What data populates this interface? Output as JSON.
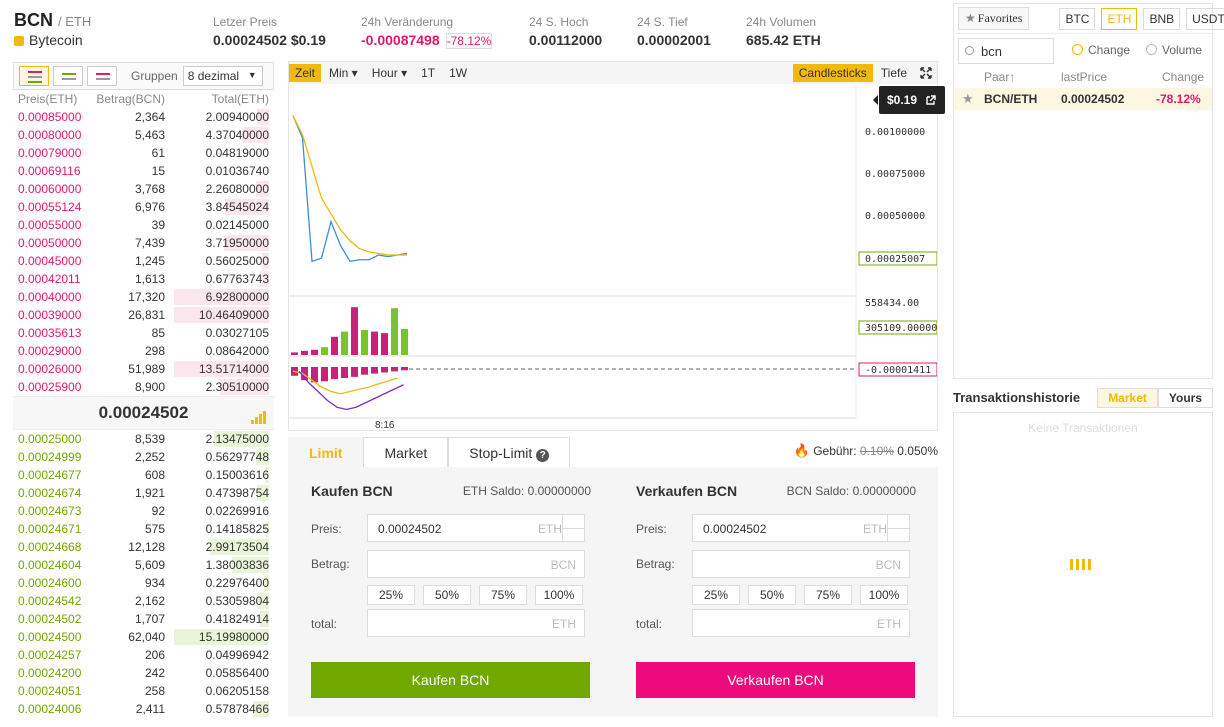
{
  "header": {
    "base": "BCN",
    "quote": "/ ETH",
    "coin_name": "Bytecoin",
    "stats": [
      {
        "label": "Letzer Preis",
        "value": "0.00024502 $0.19"
      },
      {
        "label": "24h Veränderung",
        "value": "-0.00087498",
        "pct": "-78.12%"
      },
      {
        "label": "24 S. Hoch",
        "value": "0.00112000"
      },
      {
        "label": "24 S. Tief",
        "value": "0.00002001"
      },
      {
        "label": "24h Volumen",
        "value": "685.42 ETH"
      }
    ]
  },
  "orderbook": {
    "group_label": "Gruppen",
    "group_value": "8 dezimal",
    "headers": [
      "Preis(ETH)",
      "Betrag(BCN)",
      "Total(ETH)"
    ],
    "asks": [
      {
        "price": "0.00085000",
        "amount": "2,364",
        "total": "2.00940000",
        "depth": 0.13
      },
      {
        "price": "0.00080000",
        "amount": "5,463",
        "total": "4.37040000",
        "depth": 0.28
      },
      {
        "price": "0.00079000",
        "amount": "61",
        "total": "0.04819000",
        "depth": 0.0
      },
      {
        "price": "0.00069116",
        "amount": "15",
        "total": "0.01036740",
        "depth": 0.0
      },
      {
        "price": "0.00060000",
        "amount": "3,768",
        "total": "2.26080000",
        "depth": 0.14
      },
      {
        "price": "0.00055124",
        "amount": "6,976",
        "total": "3.84545024",
        "depth": 0.46
      },
      {
        "price": "0.00055000",
        "amount": "39",
        "total": "0.02145000",
        "depth": 0.0
      },
      {
        "price": "0.00050000",
        "amount": "7,439",
        "total": "3.71950000",
        "depth": 0.47
      },
      {
        "price": "0.00045000",
        "amount": "1,245",
        "total": "0.56025000",
        "depth": 0.07
      },
      {
        "price": "0.00042011",
        "amount": "1,613",
        "total": "0.67763743",
        "depth": 0.1
      },
      {
        "price": "0.00040000",
        "amount": "17,320",
        "total": "6.92800000",
        "depth": 1.0
      },
      {
        "price": "0.00039000",
        "amount": "26,831",
        "total": "10.46409000",
        "depth": 1.0
      },
      {
        "price": "0.00035613",
        "amount": "85",
        "total": "0.03027105",
        "depth": 0.0
      },
      {
        "price": "0.00029000",
        "amount": "298",
        "total": "0.08642000",
        "depth": 0.0
      },
      {
        "price": "0.00026000",
        "amount": "51,989",
        "total": "13.51714000",
        "depth": 1.0
      },
      {
        "price": "0.00025900",
        "amount": "8,900",
        "total": "2.30510000",
        "depth": 0.52
      }
    ],
    "last_price": "0.00024502",
    "bids": [
      {
        "price": "0.00025000",
        "amount": "8,539",
        "total": "2.13475000",
        "depth": 0.58
      },
      {
        "price": "0.00024999",
        "amount": "2,252",
        "total": "0.56297748",
        "depth": 0.14
      },
      {
        "price": "0.00024677",
        "amount": "608",
        "total": "0.15003616",
        "depth": 0.04
      },
      {
        "price": "0.00024674",
        "amount": "1,921",
        "total": "0.47398754",
        "depth": 0.13
      },
      {
        "price": "0.00024673",
        "amount": "92",
        "total": "0.02269916",
        "depth": 0.0
      },
      {
        "price": "0.00024671",
        "amount": "575",
        "total": "0.14185825",
        "depth": 0.04
      },
      {
        "price": "0.00024668",
        "amount": "12,128",
        "total": "2.99173504",
        "depth": 0.62
      },
      {
        "price": "0.00024604",
        "amount": "5,609",
        "total": "1.38003836",
        "depth": 0.39
      },
      {
        "price": "0.00024600",
        "amount": "934",
        "total": "0.22976400",
        "depth": 0.05
      },
      {
        "price": "0.00024542",
        "amount": "2,162",
        "total": "0.53059804",
        "depth": 0.13
      },
      {
        "price": "0.00024502",
        "amount": "1,707",
        "total": "0.41824914",
        "depth": 0.1
      },
      {
        "price": "0.00024500",
        "amount": "62,040",
        "total": "15.19980000",
        "depth": 1.0
      },
      {
        "price": "0.00024257",
        "amount": "206",
        "total": "0.04996942",
        "depth": 0.0
      },
      {
        "price": "0.00024200",
        "amount": "242",
        "total": "0.05856400",
        "depth": 0.0
      },
      {
        "price": "0.00024051",
        "amount": "258",
        "total": "0.06205158",
        "depth": 0.0
      },
      {
        "price": "0.00024006",
        "amount": "2,411",
        "total": "0.57878466",
        "depth": 0.17
      }
    ]
  },
  "chart": {
    "toolbar": [
      "Zeit",
      "Min ▾",
      "Hour ▾",
      "1T",
      "1W"
    ],
    "candles_label": "Candlesticks",
    "depth_label": "Tiefe",
    "tooltip": "$0.19",
    "y_ticks": [
      "0.00100000",
      "0.00075000",
      "0.00050000"
    ],
    "price_tag": "0.00025007",
    "vol_max": "558434.00",
    "vol_tag": "305109.00000",
    "macd_tag": "-0.00001411",
    "time_label": "8:16"
  },
  "chart_data": {
    "type": "line",
    "price": [
      0.00112,
      0.00098,
      0.0002,
      0.00022,
      0.00045,
      0.0003,
      0.0002,
      0.00021,
      0.00021,
      0.00024,
      0.00023,
      0.00024,
      0.00025
    ],
    "ma": [
      0.00112,
      0.001,
      0.0008,
      0.0006,
      0.0005,
      0.0004,
      0.00033,
      0.00028,
      0.00026,
      0.00025,
      0.00024,
      0.00024,
      0.00024
    ],
    "volume": [
      0.05,
      0.08,
      0.1,
      0.15,
      0.35,
      0.45,
      0.92,
      0.48,
      0.45,
      0.42,
      0.9,
      0.5
    ],
    "volume_up": [
      false,
      false,
      false,
      true,
      false,
      true,
      false,
      true,
      false,
      false,
      true,
      true
    ],
    "macd": [
      -0.4,
      -0.6,
      -0.7,
      -0.65,
      -0.55,
      -0.5,
      -0.45,
      -0.35,
      -0.3,
      -0.25,
      -0.2,
      -0.15
    ],
    "macd_signal": [
      -0.05,
      -0.1,
      -0.25,
      -0.4,
      -0.5,
      -0.55,
      -0.5,
      -0.45,
      -0.4,
      -0.33,
      -0.27,
      -0.2
    ],
    "macd_fast": [
      -0.05,
      -0.3,
      -0.5,
      -0.7,
      -0.85,
      -0.9,
      -0.85,
      -0.75,
      -0.65,
      -0.55,
      -0.45,
      -0.35
    ]
  },
  "trade": {
    "tabs": [
      "Limit",
      "Market",
      "Stop-Limit"
    ],
    "fee_label": "Gebühr:",
    "fee_old": "0.10%",
    "fee_new": "0.050%",
    "buy": {
      "title": "Kaufen BCN",
      "balance": "ETH Saldo: 0.00000000",
      "price_label": "Preis:",
      "price_value": "0.00024502",
      "price_unit": "ETH",
      "amount_label": "Betrag:",
      "amount_unit": "BCN",
      "total_label": "total:",
      "total_unit": "ETH",
      "button": "Kaufen BCN"
    },
    "sell": {
      "title": "Verkaufen BCN",
      "balance": "BCN Saldo: 0.00000000",
      "price_label": "Preis:",
      "price_value": "0.00024502",
      "price_unit": "ETH",
      "amount_label": "Betrag:",
      "amount_unit": "BCN",
      "total_label": "total:",
      "total_unit": "ETH",
      "button": "Verkaufen BCN"
    },
    "percents": [
      "25%",
      "50%",
      "75%",
      "100%"
    ]
  },
  "market": {
    "favorites": "Favorites",
    "quotes": [
      "BTC",
      "ETH",
      "BNB",
      "USDT"
    ],
    "search_value": "bcn",
    "radio_change": "Change",
    "radio_volume": "Volume",
    "headers": [
      "Paar",
      "lastPrice",
      "Change"
    ],
    "row": {
      "pair": "BCN/ETH",
      "price": "0.00024502",
      "change": "-78.12%"
    }
  },
  "history": {
    "title": "Transaktionshistorie",
    "tabs": [
      "Market",
      "Yours"
    ],
    "empty": "Keine Transaktionen"
  },
  "colors": {
    "accent": "#f0b90b",
    "buy": "#70a800",
    "sell": "#e0196e"
  }
}
